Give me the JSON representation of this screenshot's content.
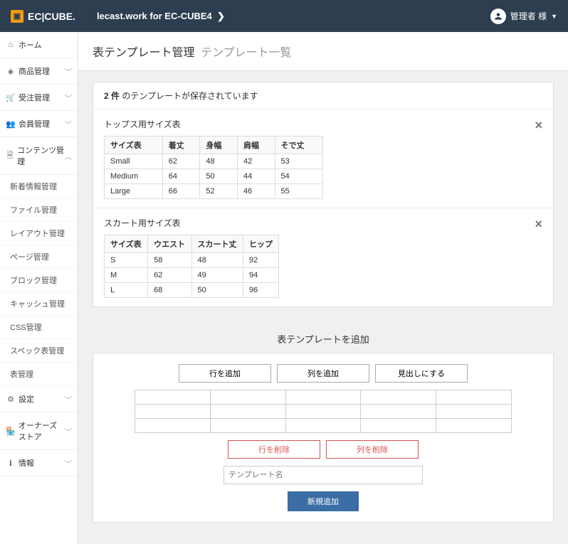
{
  "header": {
    "logo": "EC|CUBE",
    "title": "lecast.work for EC-CUBE4",
    "user": "管理者 様"
  },
  "sidebar": {
    "items": [
      {
        "icon": "home",
        "label": "ホーム"
      },
      {
        "icon": "cube",
        "label": "商品管理",
        "sub": true
      },
      {
        "icon": "cart",
        "label": "受注管理",
        "sub": true
      },
      {
        "icon": "users",
        "label": "会員管理",
        "sub": true
      },
      {
        "icon": "file",
        "label": "コンテンツ管理",
        "sub": true,
        "open": true
      }
    ],
    "subitems": [
      "新着情報管理",
      "ファイル管理",
      "レイアウト管理",
      "ページ管理",
      "ブロック管理",
      "キャッシュ管理",
      "CSS管理",
      "スペック表管理",
      "表管理"
    ],
    "items2": [
      {
        "icon": "cog",
        "label": "設定",
        "sub": true
      },
      {
        "icon": "store",
        "label": "オーナーズストア",
        "sub": true
      },
      {
        "icon": "info",
        "label": "情報",
        "sub": true
      }
    ]
  },
  "page": {
    "title": "表テンプレート管理",
    "subtitle": "テンプレート一覧",
    "count_prefix": "2 件",
    "count_suffix": " のテンプレートが保存されています"
  },
  "templates": [
    {
      "title": "トップス用サイズ表",
      "headers": [
        "サイズ表",
        "着丈",
        "身幅",
        "肩幅",
        "そで丈"
      ],
      "rows": [
        [
          "Small",
          "62",
          "48",
          "42",
          "53"
        ],
        [
          "Medium",
          "64",
          "50",
          "44",
          "54"
        ],
        [
          "Large",
          "66",
          "52",
          "46",
          "55"
        ]
      ]
    },
    {
      "title": "スカート用サイズ表",
      "headers": [
        "サイズ表",
        "ウエスト",
        "スカート丈",
        "ヒップ"
      ],
      "rows": [
        [
          "S",
          "58",
          "48",
          "92"
        ],
        [
          "M",
          "62",
          "49",
          "94"
        ],
        [
          "L",
          "68",
          "50",
          "96"
        ]
      ]
    }
  ],
  "add": {
    "heading": "表テンプレートを追加",
    "btn_add_row": "行を追加",
    "btn_add_col": "列を追加",
    "btn_heading": "見出しにする",
    "btn_del_row": "行を削除",
    "btn_del_col": "列を削除",
    "placeholder": "テンプレート名",
    "submit": "新規追加"
  }
}
